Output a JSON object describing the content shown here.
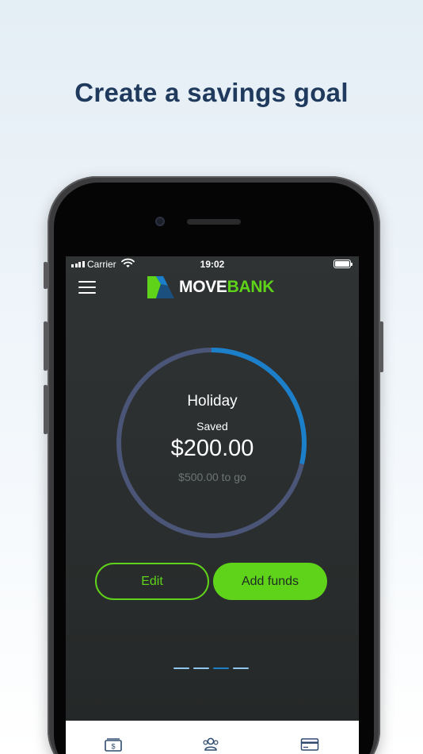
{
  "headline": "Create a savings goal",
  "status_bar": {
    "carrier": "Carrier",
    "time": "19:02",
    "icons": [
      "signal-icon",
      "wifi-icon",
      "battery-icon"
    ]
  },
  "header": {
    "menu_icon": "hamburger-menu-icon",
    "logo": {
      "word1": "MOVE",
      "word2": "BANK"
    }
  },
  "goal": {
    "name": "Holiday",
    "saved_label": "Saved",
    "saved_amount": "$200.00",
    "remaining": "$500.00 to go",
    "progress": 0.286
  },
  "actions": {
    "edit_label": "Edit",
    "add_funds_label": "Add funds"
  },
  "pager": {
    "count": 4,
    "active": 2
  },
  "tab_bar": {
    "items": [
      {
        "icon": "money-icon"
      },
      {
        "icon": "people-icon"
      },
      {
        "icon": "card-icon"
      }
    ]
  },
  "colors": {
    "brand_green": "#5fd31a",
    "ring_progress": "#1b7fc9",
    "ring_track": "#4a5577",
    "headline": "#1f3a5d",
    "screen_bg": "#2c3030"
  }
}
